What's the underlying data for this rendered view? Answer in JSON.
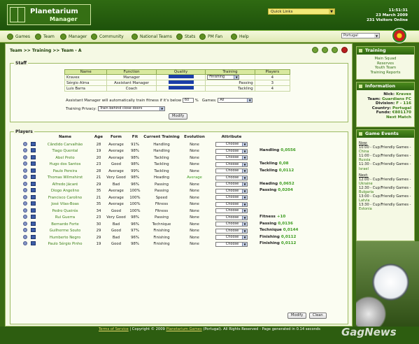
{
  "header": {
    "logo_line1": "Planetarium",
    "logo_line2": "Manager",
    "quick_links": "Quick Links",
    "time": "11:51:31",
    "date": "23 March 2009",
    "online": "231 Visitors Online"
  },
  "nav": [
    "Games",
    "Team",
    "Manager",
    "Community",
    "National Teams",
    "Stats",
    "PM Fan",
    "Help"
  ],
  "language": "Portugal",
  "breadcrumb": "Team >> Training >> Team - A",
  "staff": {
    "title": "Staff",
    "headers": [
      "Name",
      "Function",
      "Quality",
      "Training",
      "Players"
    ],
    "rows": [
      {
        "name": "Kravex",
        "function": "Manager",
        "training": "Finishing",
        "players": "4"
      },
      {
        "name": "Sérgio Alma",
        "function": "Assistant Manager",
        "training": "Passing",
        "players": "3"
      },
      {
        "name": "Luis Barra",
        "function": "Coach",
        "training": "Tackling",
        "players": "4"
      }
    ],
    "fitness_label": "Assistant Manager will automatically train fitness if it's below",
    "fitness_value": "60",
    "pct": "%",
    "games_label": "Games:",
    "games_value": "All",
    "privacy_label": "Training Privacy:",
    "privacy_value": "Train behind close doors",
    "modify": "Modify"
  },
  "players": {
    "title": "Players",
    "headers": [
      "Name",
      "Age",
      "Form",
      "Fit",
      "Current Training",
      "Evolution",
      "Attribute"
    ],
    "rows": [
      [
        "Cândido Carvalhão",
        "28",
        "Average",
        "91%",
        "Handling",
        "None",
        "Choose"
      ],
      [
        "Tiago Quental",
        "19",
        "Average",
        "98%",
        "Handling",
        "None",
        "Choose"
      ],
      [
        "Abel Preto",
        "20",
        "Average",
        "98%",
        "Tackling",
        "None",
        "Choose"
      ],
      [
        "Hugo dos Santos",
        "23",
        "Good",
        "98%",
        "Tackling",
        "None",
        "Choose"
      ],
      [
        "Paulo Pereira",
        "28",
        "Average",
        "99%",
        "Tackling",
        "None",
        "Choose"
      ],
      [
        "Thomas Wilmshirst",
        "21",
        "Very Good",
        "98%",
        "Heading",
        "Average",
        "Choose"
      ],
      [
        "Alfredo Jácaré",
        "29",
        "Bad",
        "96%",
        "Passing",
        "None",
        "Choose"
      ],
      [
        "Diogo Angelino",
        "35",
        "Average",
        "100%",
        "Passing",
        "None",
        "Choose"
      ],
      [
        "Francisco Carolino",
        "21",
        "Average",
        "100%",
        "Speed",
        "None",
        "Choose"
      ],
      [
        "José Vilas-Boas",
        "35",
        "Average",
        "100%",
        "Fitness",
        "None",
        "Choose"
      ],
      [
        "Pedro Queirós",
        "34",
        "Good",
        "100%",
        "Fitness",
        "None",
        "Choose"
      ],
      [
        "Rui Guerra",
        "23",
        "Very Good",
        "98%",
        "Passing",
        "None",
        "Choose"
      ],
      [
        "Bernardo Forte",
        "30",
        "Bad",
        "96%",
        "Technique",
        "None",
        "Choose"
      ],
      [
        "Guilherme Souto",
        "29",
        "Good",
        "97%",
        "Finishing",
        "None",
        "Choose"
      ],
      [
        "Humberto Negro",
        "29",
        "Bad",
        "96%",
        "Finishing",
        "None",
        "Choose"
      ],
      [
        "Paulo Sérgio Pinho",
        "19",
        "Good",
        "98%",
        "Finishing",
        "None",
        "Choose"
      ]
    ],
    "gains": [
      {
        "row": 0,
        "label": "Handling",
        "value": "0,0556"
      },
      {
        "row": 2,
        "label": "Tackling",
        "value": "0,08"
      },
      {
        "row": 3,
        "label": "Tackling",
        "value": "0,0112"
      },
      {
        "row": 5,
        "label": "Heading",
        "value": "0,0652"
      },
      {
        "row": 6,
        "label": "Passing",
        "value": "0,0204"
      },
      {
        "row": 10,
        "label": "Fitness",
        "value": "+10"
      },
      {
        "row": 11,
        "label": "Passing",
        "value": "0,0136"
      },
      {
        "row": 12,
        "label": "Technique",
        "value": "0,0144"
      },
      {
        "row": 13,
        "label": "Finishing",
        "value": "0,0112"
      },
      {
        "row": 14,
        "label": "Finishing",
        "value": "0,0112"
      }
    ],
    "modify": "Modify",
    "clean": "Clean"
  },
  "side": {
    "training_title": "Training",
    "training_links": [
      "Main Squad",
      "Reserves",
      "Youth Team",
      "Training Reports"
    ],
    "info_title": "Information",
    "nick_label": "Nick:",
    "nick": "Kravex",
    "team_label": "Team:",
    "team": "Guardians FC",
    "div_label": "Division:",
    "div": "F - 116",
    "country_label": "Country:",
    "country": "Portugal",
    "funds_label": "Funds:",
    "funds": "€801170",
    "next_match": "Next Match",
    "events_title": "Game Events",
    "now": "Now:",
    "now_events": [
      [
        "10:00 - Cup/Friendly Games -",
        "China"
      ],
      [
        "11:00 - Cup/Friendly Games -",
        "Russia"
      ],
      [
        "11:30 - Cup/Friendly Games -",
        "Israel"
      ]
    ],
    "next": "Next:",
    "next_events": [
      [
        "12:00 - Cup/Friendly Games -",
        "Ukraine"
      ],
      [
        "12:30 - Cup/Friendly Games -",
        "Bulgaria"
      ],
      [
        "13:00 - Cup/Friendly Games -",
        "Latvia"
      ],
      [
        "13:30 - Cup/Friendly Games -",
        "Estonia"
      ]
    ]
  },
  "footer": {
    "tos": "Terms of Service",
    "copy": "| Copyright © 2009",
    "pg": "Planetarium Games",
    "rest": "(Portugal). All Rights Reserved - Page generated in 0.14 seconds"
  },
  "watermark": "GagNews"
}
